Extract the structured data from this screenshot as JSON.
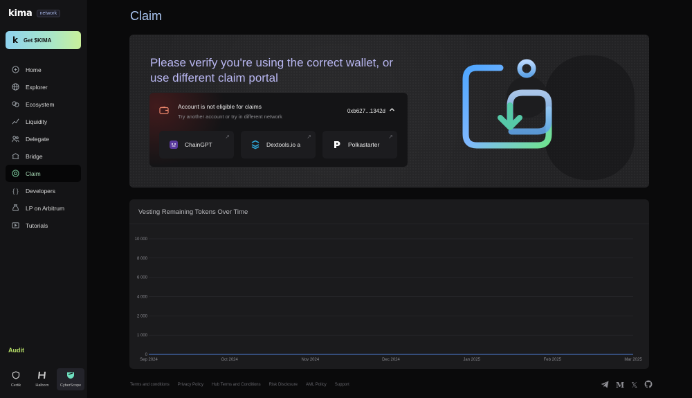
{
  "brand": {
    "name": "kima",
    "tag": "network"
  },
  "get_button": {
    "icon": "k",
    "label": "Get $KIMA"
  },
  "nav": [
    {
      "label": "Home",
      "icon": "home-icon"
    },
    {
      "label": "Explorer",
      "icon": "globe-icon"
    },
    {
      "label": "Ecosystem",
      "icon": "ecosystem-icon"
    },
    {
      "label": "Liquidity",
      "icon": "chart-line-icon"
    },
    {
      "label": "Delegate",
      "icon": "people-icon"
    },
    {
      "label": "Bridge",
      "icon": "bridge-icon"
    },
    {
      "label": "Claim",
      "icon": "claim-icon",
      "active": true
    },
    {
      "label": "Developers",
      "icon": "braces-icon"
    },
    {
      "label": "LP on Arbitrum",
      "icon": "money-bag-icon"
    },
    {
      "label": "Tutorials",
      "icon": "video-icon"
    }
  ],
  "audit": {
    "title": "Audit",
    "items": [
      {
        "label": "Certik",
        "icon": "certik-icon"
      },
      {
        "label": "Halborn",
        "icon": "halborn-icon"
      },
      {
        "label": "CyberScope",
        "icon": "cyberscope-icon",
        "selected": true
      }
    ]
  },
  "page": {
    "title": "Claim"
  },
  "banner": {
    "heading": "Please verify you're using the correct wallet, or use different claim portal",
    "account": {
      "title": "Account is not eligible for claims",
      "subtitle": "Try another account  or try in different network",
      "address": "0xb627...1342d"
    },
    "portals": [
      {
        "label": "ChainGPT",
        "icon": "chaingpt-icon"
      },
      {
        "label": "Dextools.io a",
        "icon": "dextools-icon"
      },
      {
        "label": "Polkastarter",
        "icon": "polkastarter-icon"
      }
    ]
  },
  "chart_data": {
    "type": "line",
    "title": "Vesting Remaining Tokens Over Time",
    "xlabel": "",
    "ylabel": "",
    "y_ticks": [
      "10 000",
      "8 000",
      "6 000",
      "4 000",
      "2 000",
      "1 000",
      "0"
    ],
    "x_ticks": [
      "Sep 2024",
      "Oct 2024",
      "Nov 2024",
      "Dec 2024",
      "Jan 2025",
      "Feb 2025",
      "Mar 2025"
    ],
    "ylim": [
      0,
      10000
    ],
    "grid": true,
    "series": [
      {
        "values": [
          0,
          0,
          0,
          0,
          0,
          0,
          0
        ],
        "color": "#4f7fd6"
      }
    ]
  },
  "footer": {
    "links": [
      "Terms and conditions",
      "Privacy Policy",
      "Hub Terms and Conditions",
      "Risk Disclosure",
      "AML Policy",
      "Support"
    ]
  },
  "socials": [
    "telegram-icon",
    "medium-icon",
    "x-icon",
    "github-icon"
  ],
  "colors": {
    "accent_green": "#7ed2a1",
    "title_blue": "#a9c4f0",
    "audit_lime": "#b8e068"
  }
}
